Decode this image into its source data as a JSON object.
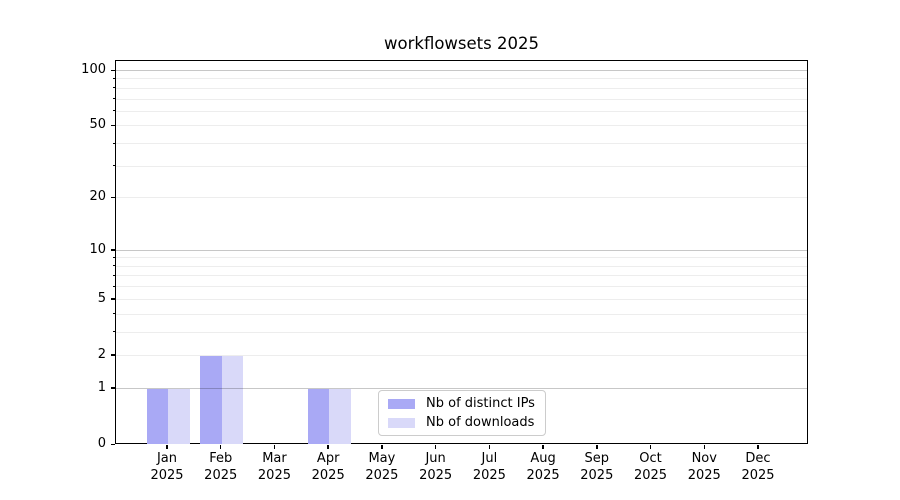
{
  "chart_data": {
    "type": "bar",
    "title": "workflowsets 2025",
    "categories": [
      "Jan",
      "Feb",
      "Mar",
      "Apr",
      "May",
      "Jun",
      "Jul",
      "Aug",
      "Sep",
      "Oct",
      "Nov",
      "Dec"
    ],
    "year_label": "2025",
    "series": [
      {
        "name": "Nb of distinct IPs",
        "color": "#a9a9f5",
        "values": [
          1,
          2,
          0,
          1,
          0,
          0,
          0,
          0,
          0,
          0,
          0,
          0
        ]
      },
      {
        "name": "Nb of downloads",
        "color": "#d9d9f9",
        "values": [
          1,
          2,
          0,
          1,
          0,
          0,
          0,
          0,
          0,
          0,
          0,
          0
        ]
      }
    ],
    "xlabel": "",
    "ylabel": "",
    "yscale": "log1p",
    "ylim": [
      0,
      112
    ],
    "ytick_labels": [
      0,
      1,
      2,
      5,
      10,
      20,
      50,
      100
    ],
    "grid": true,
    "grid_major_values": [
      1,
      10,
      100
    ],
    "grid_minor_values": [
      2,
      3,
      4,
      5,
      6,
      7,
      8,
      9,
      20,
      30,
      40,
      50,
      60,
      70,
      80,
      90
    ],
    "legend_position": "lower-center"
  },
  "colors": {
    "axis": "#000000",
    "background": "#ffffff",
    "major_grid": "#c7c7c7",
    "minor_grid": "#ededed",
    "legend_border": "#cccccc"
  }
}
